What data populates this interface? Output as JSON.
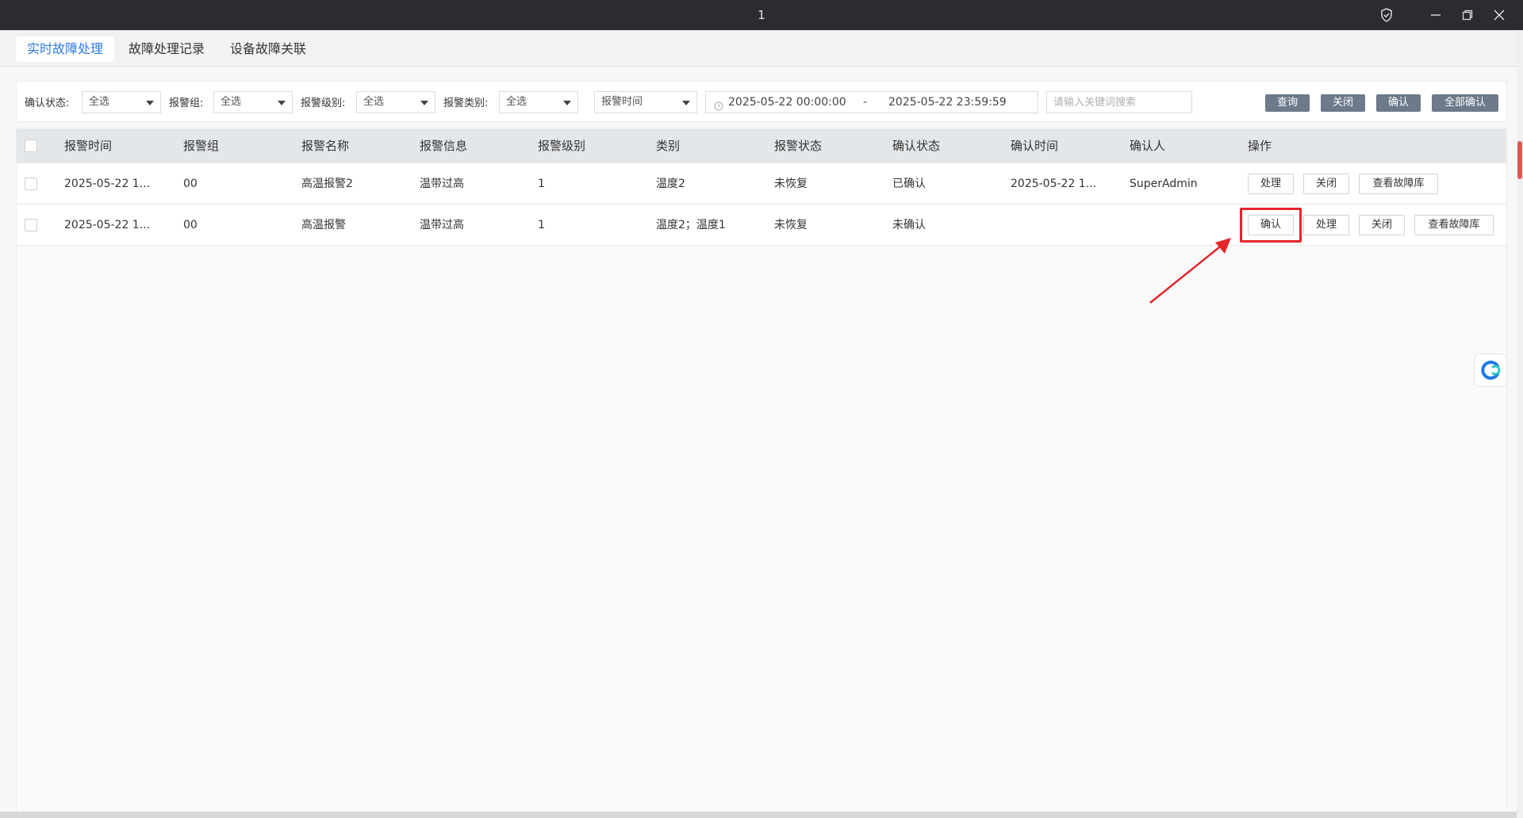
{
  "window": {
    "title": "1"
  },
  "tabs": [
    {
      "label": "实时故障处理",
      "active": true
    },
    {
      "label": "故障处理记录",
      "active": false
    },
    {
      "label": "设备故障关联",
      "active": false
    }
  ],
  "filters": {
    "confirm_status": {
      "label": "确认状态:",
      "value": "全选"
    },
    "alarm_group": {
      "label": "报警组:",
      "value": "全选"
    },
    "alarm_level": {
      "label": "报警级别:",
      "value": "全选"
    },
    "alarm_type": {
      "label": "报警类别:",
      "value": "全选"
    },
    "time_field": {
      "value": "报警时间"
    },
    "date_start": "2025-05-22 00:00:00",
    "date_sep": "-",
    "date_end": "2025-05-22 23:59:59",
    "search_placeholder": "请输入关键词搜索"
  },
  "toolbar": {
    "query": "查询",
    "close": "关闭",
    "confirm": "确认",
    "confirm_all": "全部确认"
  },
  "table": {
    "columns": [
      "报警时间",
      "报警组",
      "报警名称",
      "报警信息",
      "报警级别",
      "类别",
      "报警状态",
      "确认状态",
      "确认时间",
      "确认人",
      "操作"
    ],
    "rows": [
      {
        "alarm_time": "2025-05-22 1...",
        "group": "00",
        "name": "高温报警2",
        "info": "温带过高",
        "level": "1",
        "category": "温度2",
        "alarm_status": "未恢复",
        "confirm_status": "已确认",
        "confirm_time": "2025-05-22 1...",
        "confirmer": "SuperAdmin",
        "actions": [
          "处理",
          "关闭",
          "查看故障库"
        ]
      },
      {
        "alarm_time": "2025-05-22 1...",
        "group": "00",
        "name": "高温报警",
        "info": "温带过高",
        "level": "1",
        "category": "温度2；温度1",
        "alarm_status": "未恢复",
        "confirm_status": "未确认",
        "confirm_time": "",
        "confirmer": "",
        "actions": [
          "确认",
          "处理",
          "关闭",
          "查看故障库"
        ]
      }
    ]
  },
  "colors": {
    "accent": "#2f7be5",
    "highlight": "#e5262b",
    "titlebar": "#2b2c30",
    "toolbar_button": "#6c7a89"
  },
  "icons": [
    "shield-icon",
    "minimize-icon",
    "restore-icon",
    "close-icon",
    "clock-icon",
    "caret-down-icon",
    "assistant-icon",
    "arrow-annotation"
  ]
}
